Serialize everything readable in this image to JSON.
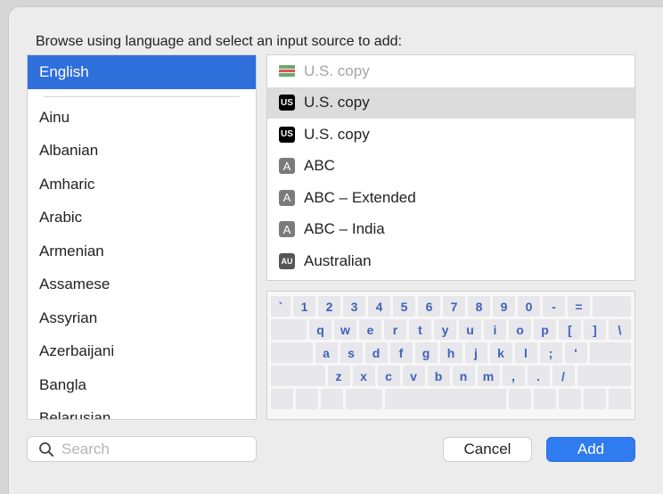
{
  "dialog": {
    "heading": "Browse using language and select an input source to add:"
  },
  "languages": {
    "selected": "English",
    "items": [
      "Ainu",
      "Albanian",
      "Amharic",
      "Arabic",
      "Armenian",
      "Assamese",
      "Assyrian",
      "Azerbaijani",
      "Bangla",
      "Belarusian"
    ]
  },
  "sources": {
    "items": [
      {
        "label": "U.S. copy",
        "badge": "",
        "icon": "flag-icon",
        "state": "dimmed"
      },
      {
        "label": "U.S. copy",
        "badge": "US",
        "icon": "us-badge-icon",
        "state": "highlighted"
      },
      {
        "label": "U.S. copy",
        "badge": "US",
        "icon": "us-badge-icon",
        "state": "normal"
      },
      {
        "label": "ABC",
        "badge": "A",
        "icon": "a-badge-icon",
        "state": "normal"
      },
      {
        "label": "ABC – Extended",
        "badge": "A",
        "icon": "a-badge-icon",
        "state": "normal"
      },
      {
        "label": "ABC – India",
        "badge": "A",
        "icon": "a-badge-icon",
        "state": "normal"
      },
      {
        "label": "Australian",
        "badge": "AU",
        "icon": "au-badge-icon",
        "state": "normal"
      }
    ]
  },
  "keyboard": {
    "row1": [
      "`",
      "1",
      "2",
      "3",
      "4",
      "5",
      "6",
      "7",
      "8",
      "9",
      "0",
      "-",
      "="
    ],
    "row2": [
      "q",
      "w",
      "e",
      "r",
      "t",
      "y",
      "u",
      "i",
      "o",
      "p",
      "[",
      "]",
      "\\"
    ],
    "row3": [
      "a",
      "s",
      "d",
      "f",
      "g",
      "h",
      "j",
      "k",
      "l",
      ";",
      "'"
    ],
    "row4": [
      "z",
      "x",
      "c",
      "v",
      "b",
      "n",
      "m",
      ",",
      ".",
      "/"
    ]
  },
  "search": {
    "placeholder": "Search",
    "value": ""
  },
  "buttons": {
    "cancel": "Cancel",
    "add": "Add"
  },
  "colors": {
    "accent": "#2f6fdc",
    "add_button": "#2f7bf0",
    "key_text": "#3e63b8"
  }
}
